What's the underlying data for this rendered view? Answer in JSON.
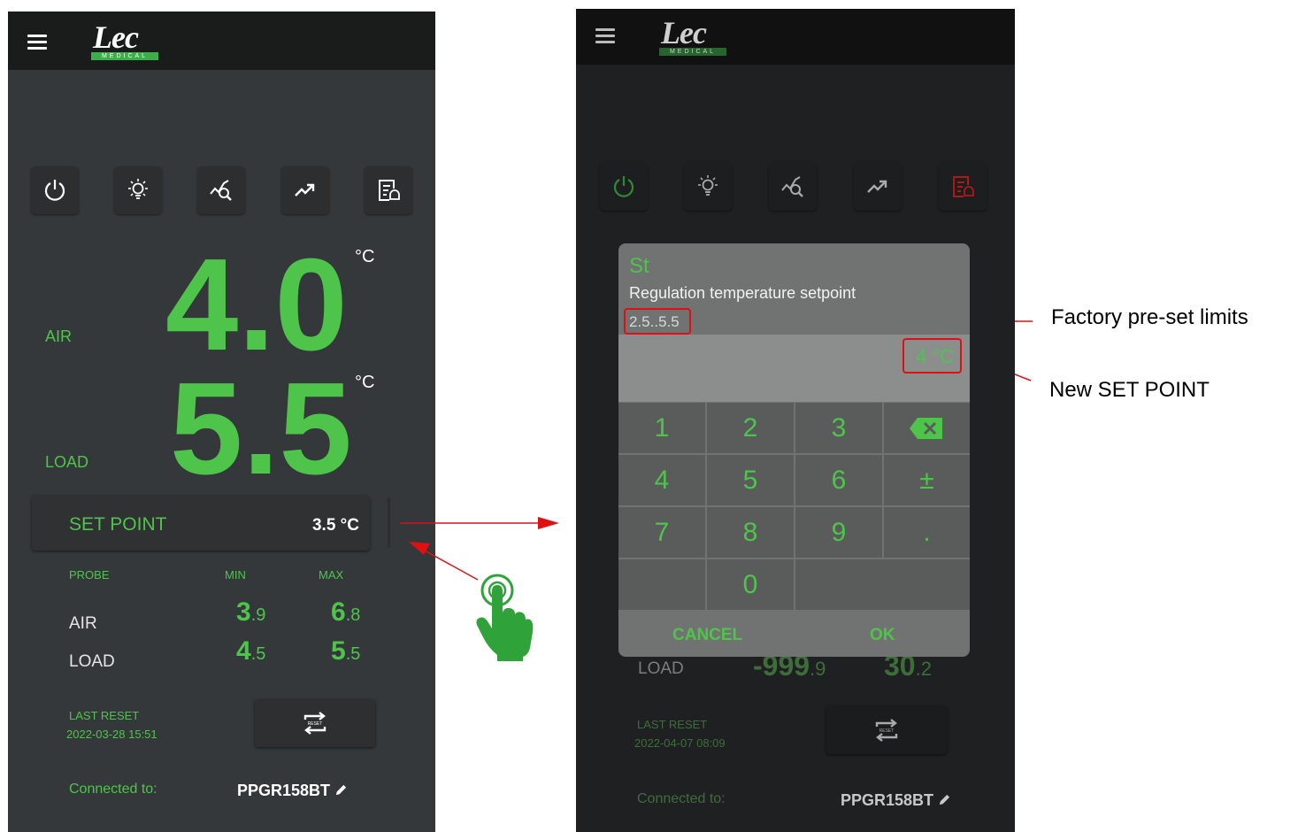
{
  "brand": {
    "logo_text": "Lec",
    "logo_sub": "MEDICAL"
  },
  "left": {
    "air_label": "AIR",
    "air_value": "4.0",
    "load_label": "LOAD",
    "load_value": "5.5",
    "unit": "°C",
    "setpoint_label": "SET POINT",
    "setpoint_value": "3.5 °C",
    "probe_header": "PROBE",
    "min_header": "MIN",
    "max_header": "MAX",
    "rows": [
      {
        "name": "AIR",
        "min_int": "3",
        "min_dec": ".9",
        "max_int": "6",
        "max_dec": ".8"
      },
      {
        "name": "LOAD",
        "min_int": "4",
        "min_dec": ".5",
        "max_int": "5",
        "max_dec": ".5"
      }
    ],
    "last_reset_label": "LAST RESET",
    "last_reset_time": "2022-03-28 15:51",
    "connected_label": "Connected to:",
    "device": "PPGR158BT"
  },
  "right": {
    "dialog": {
      "code": "St",
      "description": "Regulation temperature setpoint",
      "limits": "2.5..5.5",
      "value": "4 °C",
      "keys": [
        "1",
        "2",
        "3",
        "⌫",
        "4",
        "5",
        "6",
        "±",
        "7",
        "8",
        "9",
        ".",
        "",
        "0"
      ],
      "cancel": "CANCEL",
      "ok": "OK"
    },
    "bg_load_label": "LOAD",
    "bg_load_min": "-999",
    "bg_load_min_dec": ".9",
    "bg_load_max": "30",
    "bg_load_max_dec": ".2",
    "last_reset_label": "LAST RESET",
    "last_reset_time": "2022-04-07 08:09",
    "connected_label": "Connected to:",
    "device": "PPGR158BT"
  },
  "annotations": {
    "limits": "Factory pre-set limits",
    "setpoint": "New SET POINT"
  },
  "icons": [
    "power-icon",
    "light-bulb-icon",
    "analysis-icon",
    "trend-icon",
    "alarm-log-icon",
    "pencil-icon",
    "reset-icon",
    "hand-pointer-icon",
    "backspace-icon"
  ],
  "colors": {
    "accent": "#4ec54a",
    "background": "#35383a",
    "topbar": "#1a1b1b",
    "annotation": "#e01010"
  }
}
